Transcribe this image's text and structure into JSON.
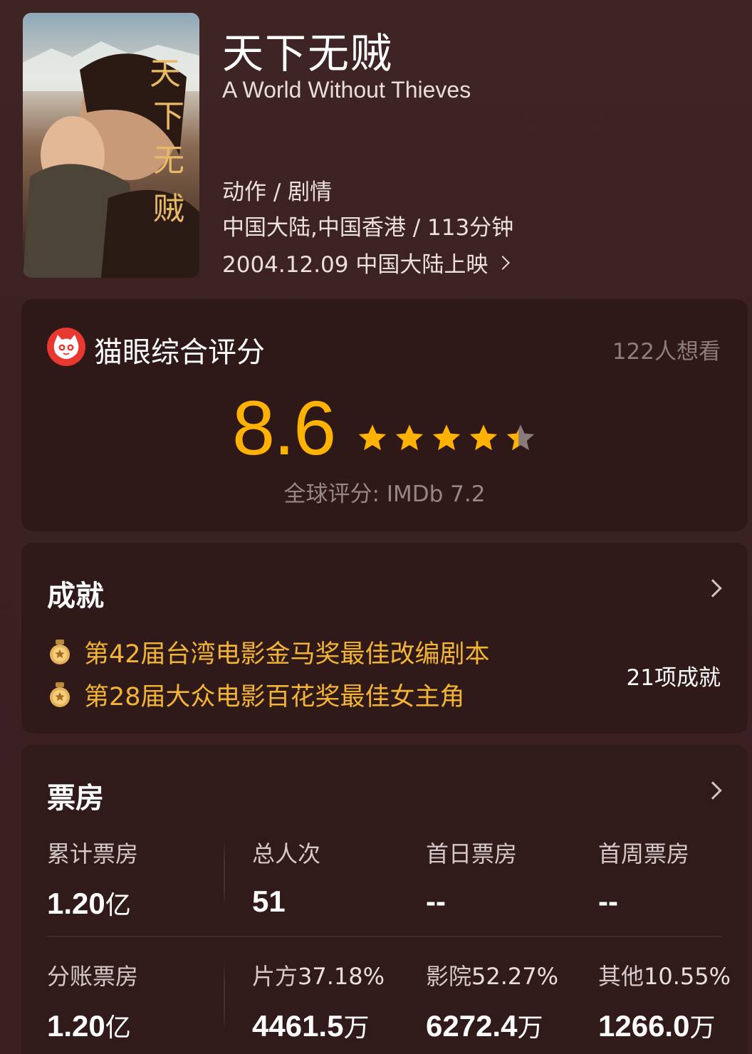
{
  "movie": {
    "poster_title": "天下无贼",
    "title": "天下无贼",
    "subtitle": "A World Without Thieves",
    "genre": "动作 / 剧情",
    "country_duration": "中国大陆,中国香港 / 113分钟",
    "release": "2004.12.09 中国大陆上映"
  },
  "rating": {
    "title": "猫眼综合评分",
    "want_count": "122人想看",
    "score": "8.6",
    "stars": 4.3,
    "imdb": "全球评分: IMDb 7.2",
    "accent_color": "#ffb300"
  },
  "achievements": {
    "title": "成就",
    "items": [
      "第42届台湾电影金马奖最佳改编剧本",
      "第28届大众电影百花奖最佳女主角"
    ],
    "count": "21项成就",
    "accent_color": "#f2b437"
  },
  "box_office": {
    "title": "票房",
    "row1": [
      {
        "label": "累计票房",
        "value": "1.20",
        "unit": "亿"
      },
      {
        "label": "总人次",
        "value": "51",
        "unit": ""
      },
      {
        "label": "首日票房",
        "value": "--",
        "unit": ""
      },
      {
        "label": "首周票房",
        "value": "--",
        "unit": ""
      }
    ],
    "row2": [
      {
        "label": "分账票房",
        "label_pct": "",
        "value": "1.20",
        "unit": "亿"
      },
      {
        "label": "片方",
        "label_pct": "37.18%",
        "value": "4461.5",
        "unit": "万"
      },
      {
        "label": "影院",
        "label_pct": "52.27%",
        "value": "6272.4",
        "unit": "万"
      },
      {
        "label": "其他",
        "label_pct": "10.55%",
        "value": "1266.0",
        "unit": "万"
      }
    ]
  }
}
